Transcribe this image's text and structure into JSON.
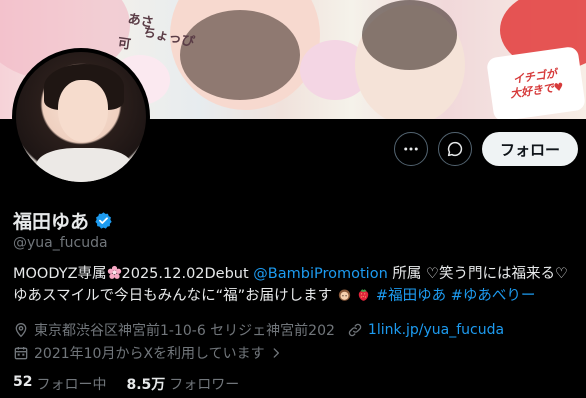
{
  "banner": {
    "text_1": "あさ",
    "text_2": "ちょっぴ",
    "text_3": "可",
    "sticker_line_1": "イチゴが",
    "sticker_line_2": "大好きで♥"
  },
  "actions": {
    "more_icon": "more-horizontal-icon",
    "message_icon": "message-icon",
    "follow_label": "フォロー"
  },
  "profile": {
    "display_name": "福田ゆあ",
    "handle": "@yua_fucuda",
    "verified_color": "#1d9bf0"
  },
  "bio": {
    "text_1": "MOODYZ専属",
    "text_2": "2025.12.02Debut ",
    "mention": "@BambiPromotion",
    "text_3": " 所属 ♡笑う門には福来る♡ゆあスマイルで今日もみんなに“福”お届けします",
    "hashtag_1": "#福田ゆあ",
    "hashtag_2": "#ゆあべりー"
  },
  "meta": {
    "location": "東京都渋谷区神宮前1-10-6 セリジェ神宮前202",
    "website": "1link.jp/yua_fucuda",
    "joined": "2021年10月からXを利用しています"
  },
  "stats": {
    "following_count": "52",
    "following_label": "フォロー中",
    "followers_count": "8.5万",
    "followers_label": "フォロワー"
  },
  "colors": {
    "background": "#000000",
    "text": "#e7e9ea",
    "secondary": "#71767b",
    "accent": "#1d9bf0"
  }
}
